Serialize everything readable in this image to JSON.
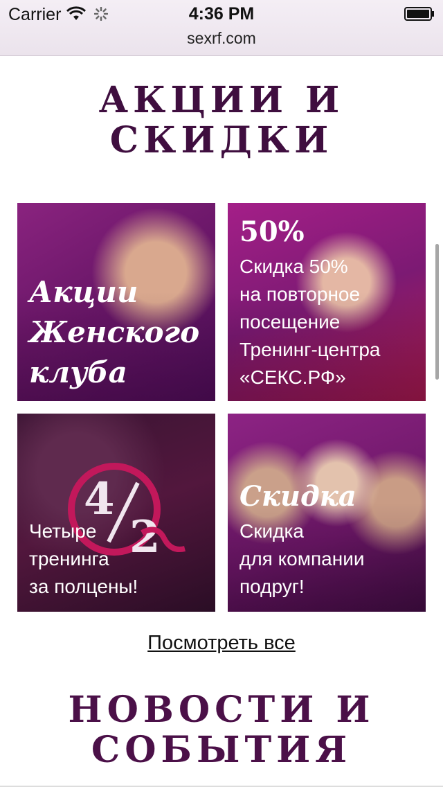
{
  "status_bar": {
    "carrier": "Carrier",
    "time": "4:36 PM"
  },
  "browser": {
    "url": "sexrf.com"
  },
  "promos": {
    "heading": "АКЦИИ И\nСКИДКИ",
    "tiles": [
      {
        "title": "Акции\nЖенского\nклуба"
      },
      {
        "big": "50%",
        "text": "Скидка 50%\nна повторное\nпосещение\nТренинг-центра\n«СЕКС.РФ»"
      },
      {
        "badge": "4/2",
        "text": "Четыре\nтренинга\nза полцены!"
      },
      {
        "heading": "Скидка",
        "text": "Скидка\nдля компании\nподруг!"
      }
    ],
    "view_all_label": "Посмотреть все"
  },
  "news": {
    "heading": "НОВОСТИ И\nСОБЫТИЯ"
  },
  "colors": {
    "heading": "#3f0e3f",
    "tile_purple": "#7c1a73",
    "accent_pink": "#c2185b"
  },
  "icons": [
    "wifi-icon",
    "loading-spinner-icon",
    "battery-icon"
  ]
}
